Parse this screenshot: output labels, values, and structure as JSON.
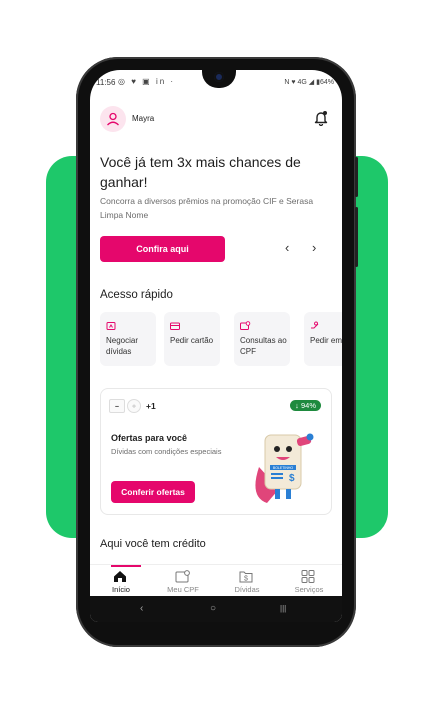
{
  "status_bar": {
    "time": "11:56",
    "left_icons": "◎ ♥ ▣ in ·",
    "right_text": "N ♥ 4G ◢ ▮64%"
  },
  "header": {
    "user_name": "Mayra"
  },
  "promo": {
    "headline": "Você já tem 3x mais chances de ganhar!",
    "description": "Concorra a diversos prêmios na promoção CIF e Serasa Limpa Nome",
    "button_label": "Confira aqui",
    "prev_arrow": "‹",
    "next_arrow": "›"
  },
  "quick_access": {
    "title": "Acesso rápido",
    "items": [
      {
        "label": "Negociar dívidas",
        "icon": "negotiate-icon"
      },
      {
        "label": "Pedir cartão",
        "icon": "card-icon"
      },
      {
        "label": "Consultas ao CPF",
        "icon": "cpf-search-icon"
      },
      {
        "label": "Pedir empréstimo",
        "icon": "loan-icon"
      }
    ]
  },
  "offers": {
    "partner_count": "+1",
    "badge": "↓ 94%",
    "title": "Ofertas para você",
    "description": "Dívidas com condições especiais",
    "button_label": "Conferir ofertas",
    "mascot_text": "BOLETINHO"
  },
  "credit": {
    "title": "Aqui você tem crédito"
  },
  "bottom_nav": {
    "items": [
      {
        "label": "Início",
        "active": true
      },
      {
        "label": "Meu CPF",
        "active": false
      },
      {
        "label": "Dívidas",
        "active": false
      },
      {
        "label": "Serviços",
        "active": false
      }
    ]
  },
  "system_nav": {
    "back": "‹",
    "home": "○",
    "recents": "|||"
  },
  "colors": {
    "brand": "#e5076c",
    "background_accent": "#1ec86a",
    "badge_green": "#1e8a3e"
  }
}
